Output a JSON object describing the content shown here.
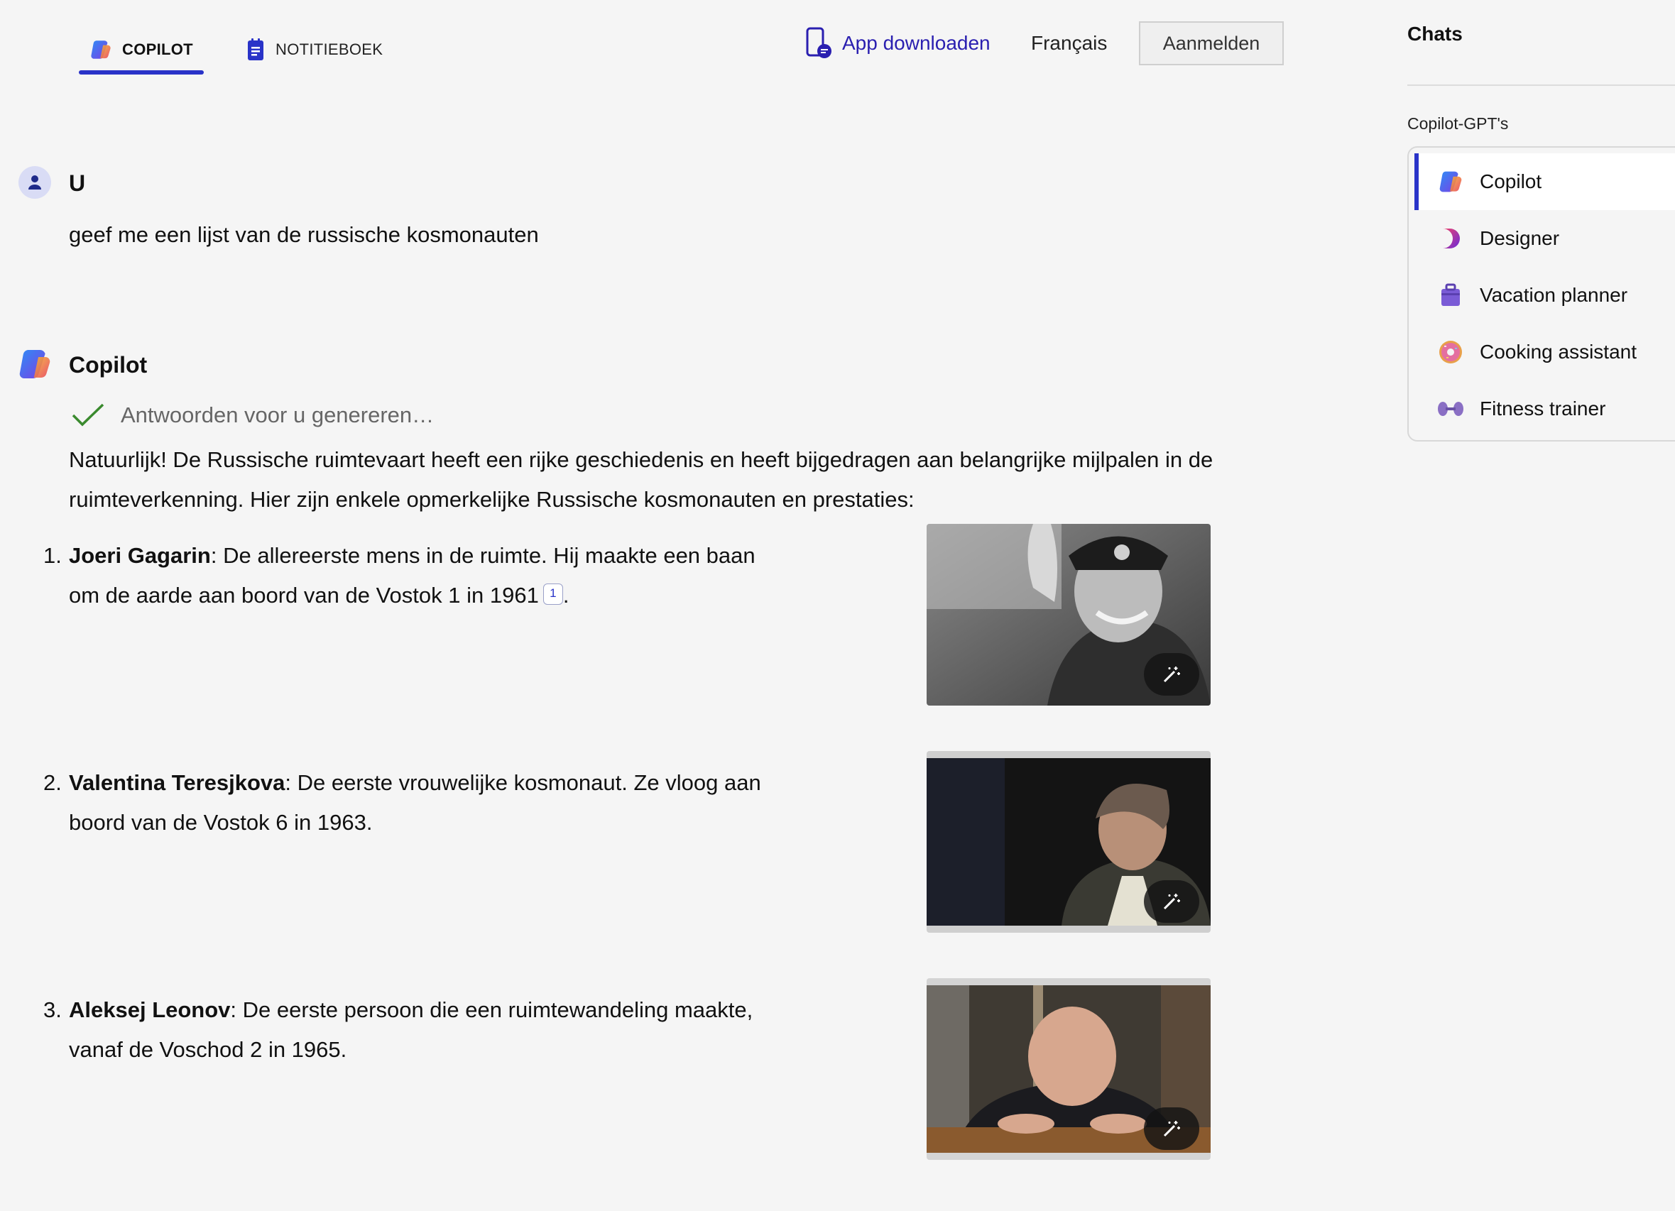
{
  "nav": {
    "tab_copilot": "COPILOT",
    "tab_notebook": "NOTITIEBOEK",
    "app_download": "App downloaden",
    "language": "Français",
    "sign_in": "Aanmelden"
  },
  "conversation": {
    "user": {
      "name": "U",
      "text": "geef me een lijst van de russische kosmonauten"
    },
    "assistant": {
      "name": "Copilot",
      "status": "Antwoorden voor u genereren…",
      "intro": "Natuurlijk! De Russische ruimtevaart heeft een rijke geschiedenis en heeft bijgedragen aan belangrijke mijlpalen in de ruimteverkenning. Hier zijn enkele opmerkelijke Russische kosmonauten en prestaties:",
      "items": [
        {
          "number": "1.",
          "name": "Joeri Gagarin",
          "text": ": De allereerste mens in de ruimte. Hij maakte een baan om de aarde aan boord van de Vostok 1 in 1961",
          "citation": "1",
          "end": "."
        },
        {
          "number": "2.",
          "name": "Valentina Teresjkova",
          "text": ": De eerste vrouwelijke kosmonaut. Ze vloog aan boord van de Vostok 6 in 1963.",
          "citation": "",
          "end": ""
        },
        {
          "number": "3.",
          "name": "Aleksej Leonov",
          "text": ": De eerste persoon die een ruimtewandeling maakte, vanaf de Voschod 2 in 1965.",
          "citation": "",
          "end": ""
        }
      ]
    }
  },
  "sidebar": {
    "title": "Chats",
    "section": "Copilot-GPT's",
    "gpts": [
      {
        "label": "Copilot",
        "icon": "copilot-icon"
      },
      {
        "label": "Designer",
        "icon": "designer-icon"
      },
      {
        "label": "Vacation planner",
        "icon": "suitcase-icon"
      },
      {
        "label": "Cooking assistant",
        "icon": "donut-icon"
      },
      {
        "label": "Fitness trainer",
        "icon": "dumbbell-icon"
      }
    ]
  },
  "colors": {
    "accent": "#2933c8",
    "check": "#3a8a2e",
    "background": "#f5f5f5"
  }
}
